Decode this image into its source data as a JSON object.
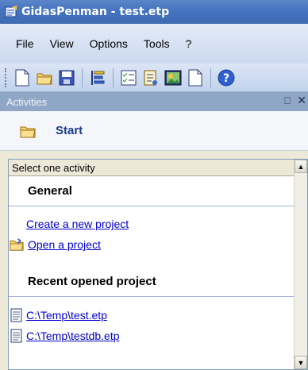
{
  "window": {
    "title": "GidasPenman - test.etp"
  },
  "menu": {
    "items": [
      "File",
      "View",
      "Options",
      "Tools",
      "?"
    ]
  },
  "toolbar": {
    "buttons": [
      "new-file-icon",
      "open-folder-icon",
      "save-icon",
      "list-icon",
      "checklist-icon",
      "document-list-icon",
      "image-icon",
      "blank-page-icon",
      "help-icon"
    ]
  },
  "pane": {
    "title": "Activities",
    "start_label": "Start",
    "list_header": "Select one activity",
    "general_title": "General",
    "create_project": "Create a new project",
    "open_project": "Open a project",
    "recent_title": "Recent opened project",
    "recent_files": [
      "C:\\Temp\\test.etp",
      "C:\\Temp\\testdb.etp"
    ]
  }
}
